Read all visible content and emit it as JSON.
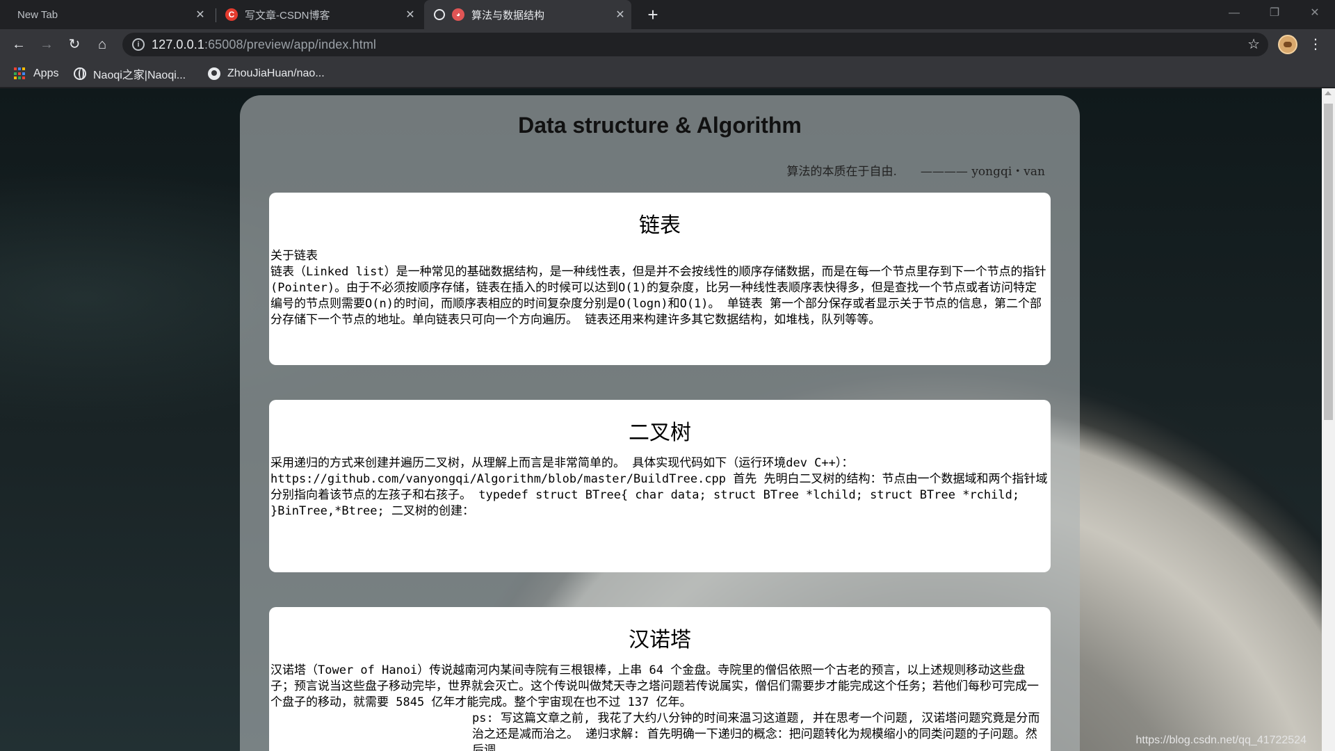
{
  "tabs": [
    {
      "title": "New Tab",
      "active": false
    },
    {
      "title": "写文章-CSDN博客",
      "favicon": "csdn-icon",
      "active": false
    },
    {
      "title": "算法与数据结构",
      "favicon": "page-icon",
      "active": true
    }
  ],
  "toolbar": {
    "url_host": "127.0.0.1",
    "url_rest": ":65008/preview/app/index.html"
  },
  "bookmarks": [
    {
      "label": "Apps",
      "icon": "apps-grid-icon"
    },
    {
      "label": "Naoqi之家|Naoqi...",
      "icon": "globe-icon"
    },
    {
      "label": "ZhouJiaHuan/nao...",
      "icon": "github-icon"
    }
  ],
  "page": {
    "title": "Data structure & Algorithm",
    "motto": "算法的本质在于自由.　　———— yongqi・van",
    "cards": [
      {
        "heading": "链表",
        "lines": [
          "关于链表",
          "链表（Linked list）是一种常见的基础数据结构，是一种线性表，但是并不会按线性的顺序存储数据，而是在每一个节点里存到下一个节点的指针(Pointer)。由于不必须按顺序存储，链表在插入的时候可以达到O(1)的复杂度，比另一种线性表顺序表快得多，但是查找一个节点或者访问特定编号的节点则需要O(n)的时间，而顺序表相应的时间复杂度分别是O(logn)和O(1)。 单链表 第一个部分保存或者显示关于节点的信息，第二个部分存储下一个节点的地址。单向链表只可向一个方向遍历。 链表还用来构建许多其它数据结构，如堆栈，队列等等。"
        ]
      },
      {
        "heading": "二叉树",
        "lines": [
          "采用递归的方式来创建并遍历二叉树，从理解上而言是非常简单的。 具体实现代码如下（运行环境dev C++）：https://github.com/vanyongqi/Algorithm/blob/master/BuildTree.cpp 首先 先明白二叉树的结构：节点由一个数据域和两个指针域分别指向着该节点的左孩子和右孩子。 typedef struct BTree{ char data; struct BTree *lchild; struct BTree *rchild; }BinTree,*Btree; 二叉树的创建："
        ]
      },
      {
        "heading": "汉诺塔",
        "lines": [
          "汉诺塔（Tower of Hanoi）传说越南河内某间寺院有三根银棒，上串 64 个金盘。寺院里的僧侣依照一个古老的预言，以上述规则移动这些盘子；预言说当这些盘子移动完毕，世界就会灭亡。这个传说叫做梵天寺之塔问题若传说属实，僧侣们需要步才能完成这个任务；若他们每秒可完成一个盘子的移动，就需要 5845 亿年才能完成。整个宇宙现在也不过 137 亿年。",
          "ps: 写这篇文章之前, 我花了大约八分钟的时间来温习这道题, 并在思考一个问题, 汉诺塔问题究竟是分而治之还是减而治之。 递归求解: 首先明确一下递归的概念：把问题转化为规模缩小的同类问题的子问题。然后调"
        ]
      }
    ]
  },
  "watermark": "https://blog.csdn.net/qq_41722524"
}
